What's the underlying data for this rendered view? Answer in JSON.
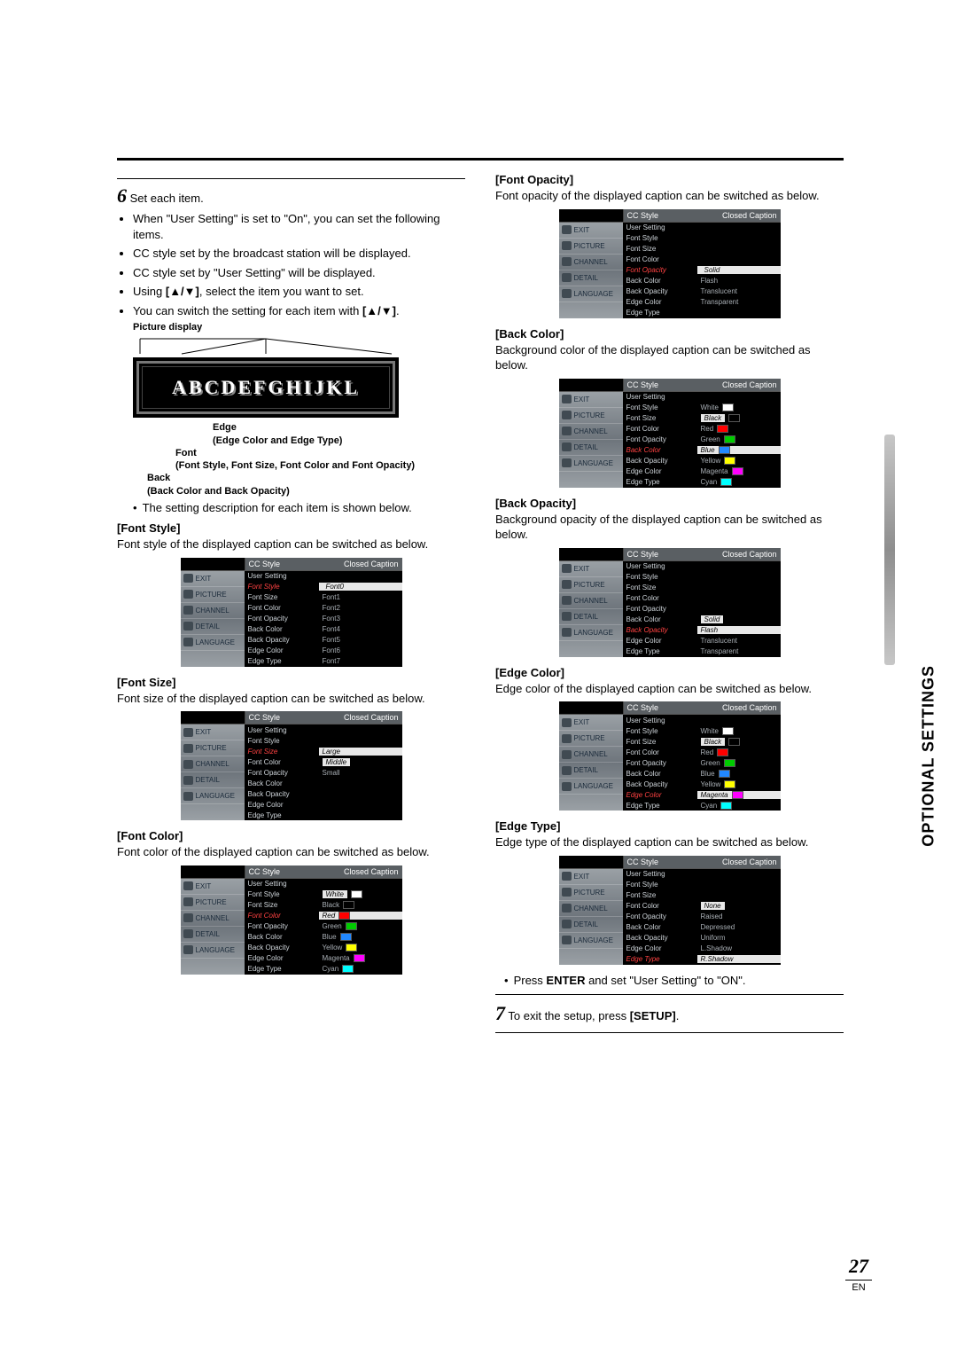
{
  "sideTab": "OPTIONAL SETTINGS",
  "pageNumber": "27",
  "pageNumberSub": "EN",
  "left": {
    "step6_num": "6",
    "step6_text": "Set each item.",
    "b1": "When \"User Setting\" is set to \"On\", you can set the following items.",
    "b2": "CC style set by the broadcast station will be displayed.",
    "b3": "CC style set by \"User Setting\" will be displayed.",
    "b4_a": "Using ",
    "b4_arrows": "[▲/▼]",
    "b4_b": ", select the item you want to set.",
    "b5_a": "You can switch the setting for each item with ",
    "b5_arrows": "[▲/▼]",
    "b5_b": ".",
    "pd_label": "Picture display",
    "pd_text": "ABCDEFGHIJKL",
    "ann_edge": "Edge",
    "ann_edge2": "(Edge Color and Edge Type)",
    "ann_font": "Font",
    "ann_font2": "(Font Style, Font Size, Font Color and Font Opacity)",
    "ann_back": "Back",
    "ann_back2": "(Back Color and Back Opacity)",
    "below_note": "The setting description for each item is shown below.",
    "fs_title": "[Font Style]",
    "fs_desc": "Font style of the displayed caption can be switched as below.",
    "fsize_title": "[Font Size]",
    "fsize_desc": "Font size of the displayed caption can be switched as below.",
    "fcol_title": "[Font Color]",
    "fcol_desc": "Font color of the displayed caption can be switched as below."
  },
  "right": {
    "fop_title": "[Font Opacity]",
    "fop_desc": "Font opacity of the displayed caption can be switched as below.",
    "bcol_title": "[Back Color]",
    "bcol_desc": "Background color of the displayed caption can be switched as below.",
    "bop_title": "[Back Opacity]",
    "bop_desc": "Background opacity of the displayed caption can be switched as below.",
    "ecol_title": "[Edge Color]",
    "ecol_desc": "Edge color of the displayed caption can be switched as below.",
    "etype_title": "[Edge Type]",
    "etype_desc": "Edge type of the displayed caption can be switched as below.",
    "enter_a": "Press ",
    "enter_b": "ENTER",
    "enter_c": " and set \"User Setting\" to \"ON\".",
    "step7_num": "7",
    "step7_a": "To exit the setup, press ",
    "step7_b": "[SETUP]",
    "step7_c": "."
  },
  "tv_common": {
    "tabL": "CC Style",
    "tabR": "Closed Caption",
    "side": [
      "EXIT",
      "PICTURE",
      "CHANNEL",
      "DETAIL",
      "LANGUAGE"
    ],
    "items": [
      "User Setting",
      "Font Style",
      "Font Size",
      "Font Color",
      "Font Opacity",
      "Back Color",
      "Back Opacity",
      "Edge Color",
      "Edge Type"
    ]
  },
  "menus": {
    "fontStyle": {
      "hi": "Font Style",
      "opts": [
        "Font0",
        "Font1",
        "Font2",
        "Font3",
        "Font4",
        "Font5",
        "Font6",
        "Font7"
      ],
      "sel": 0,
      "swatches": false,
      "optStart": 1
    },
    "fontSize": {
      "hi": "Font Size",
      "opts": [
        "Large",
        "Middle",
        "Small"
      ],
      "sel": 1,
      "swatches": false,
      "optStart": 2
    },
    "fontColor": {
      "hi": "Font Color",
      "opts": [
        "White",
        "Black",
        "Red",
        "Green",
        "Blue",
        "Yellow",
        "Magenta",
        "Cyan"
      ],
      "sel": 0,
      "swatches": true,
      "swc": [
        "#fff",
        "#000",
        "#f00",
        "#0c0",
        "#28f",
        "#ff0",
        "#f0f",
        "#0ff"
      ],
      "optStart": 1
    },
    "fontOpacity": {
      "hi": "Font Opacity",
      "opts": [
        "Solid",
        "Flash",
        "Translucent",
        "Transparent"
      ],
      "sel": 0,
      "swatches": false,
      "optStart": 4
    },
    "backColor": {
      "hi": "Back Color",
      "opts": [
        "White",
        "Black",
        "Red",
        "Green",
        "Blue",
        "Yellow",
        "Magenta",
        "Cyan"
      ],
      "sel": 1,
      "swatches": true,
      "swc": [
        "#fff",
        "#000",
        "#f00",
        "#0c0",
        "#28f",
        "#ff0",
        "#f0f",
        "#0ff"
      ],
      "optStart": 1
    },
    "backOpacity": {
      "hi": "Back Opacity",
      "opts": [
        "Solid",
        "Flash",
        "Translucent",
        "Transparent"
      ],
      "sel": 0,
      "swatches": false,
      "optStart": 5
    },
    "edgeColor": {
      "hi": "Edge Color",
      "opts": [
        "White",
        "Black",
        "Red",
        "Green",
        "Blue",
        "Yellow",
        "Magenta",
        "Cyan"
      ],
      "sel": 1,
      "swatches": true,
      "swc": [
        "#fff",
        "#000",
        "#f00",
        "#0c0",
        "#28f",
        "#ff0",
        "#f0f",
        "#0ff"
      ],
      "optStart": 1
    },
    "edgeType": {
      "hi": "Edge Type",
      "opts": [
        "None",
        "Raised",
        "Depressed",
        "Uniform",
        "L.Shadow",
        "R.Shadow"
      ],
      "sel": 0,
      "swatches": false,
      "optStart": 3
    }
  }
}
